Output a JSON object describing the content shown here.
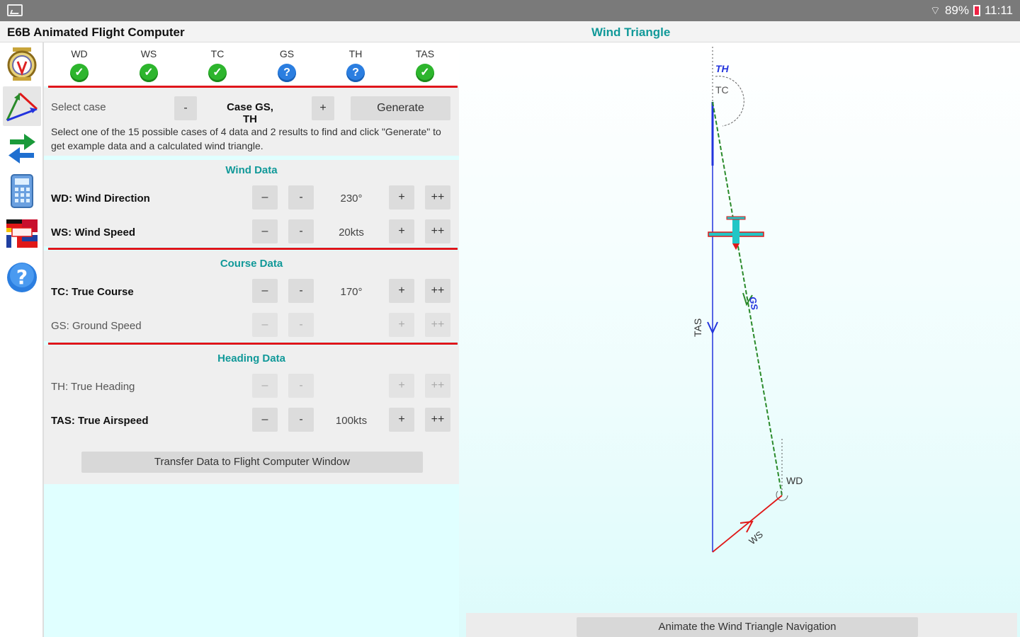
{
  "status_bar": {
    "signal": "89%",
    "time": "11:11"
  },
  "app": {
    "title": "E6B Animated Flight Computer",
    "view_title": "Wind Triangle"
  },
  "sidebar": {
    "items": [
      {
        "name": "compass-icon"
      },
      {
        "name": "wind-triangle-icon"
      },
      {
        "name": "transfer-arrows-icon"
      },
      {
        "name": "calculator-icon"
      },
      {
        "name": "language-flags-icon"
      },
      {
        "name": "help-icon"
      }
    ]
  },
  "status_items": [
    {
      "label": "WD",
      "state": "ok"
    },
    {
      "label": "WS",
      "state": "ok"
    },
    {
      "label": "TC",
      "state": "ok"
    },
    {
      "label": "GS",
      "state": "unknown"
    },
    {
      "label": "TH",
      "state": "unknown"
    },
    {
      "label": "TAS",
      "state": "ok"
    }
  ],
  "case": {
    "label": "Select case",
    "minus": "-",
    "value": "Case GS, TH",
    "plus": "+",
    "generate": "Generate",
    "description": "Select one of the 15 possible cases of 4 data and 2 results to find and  click \"Generate\" to get example data and a calculated wind triangle."
  },
  "controls": {
    "dec_big": "–",
    "dec": "-",
    "inc": "+",
    "inc_big": "++"
  },
  "wind": {
    "title": "Wind Data",
    "wd_label": "WD: Wind Direction",
    "wd_value": "230°",
    "ws_label": "WS: Wind Speed",
    "ws_value": "20kts"
  },
  "course": {
    "title": "Course Data",
    "tc_label": "TC: True Course",
    "tc_value": "170°",
    "gs_label": "GS: Ground Speed",
    "gs_value": ""
  },
  "heading": {
    "title": "Heading Data",
    "th_label": "TH: True Heading",
    "th_value": "",
    "tas_label": "TAS: True Airspeed",
    "tas_value": "100kts"
  },
  "transfer_button": "Transfer Data to Flight Computer Window",
  "diagram": {
    "labels": {
      "th": "TH",
      "tc": "TC",
      "gs": "GS",
      "tas": "TAS",
      "wd": "WD",
      "ws": "WS"
    },
    "colors": {
      "tas": "#2233dd",
      "gs": "#2a8a2a",
      "ws": "#e01818",
      "th": "#2233dd",
      "plane": "#22c6c6"
    }
  },
  "animate_button": "Animate the Wind Triangle Navigation"
}
